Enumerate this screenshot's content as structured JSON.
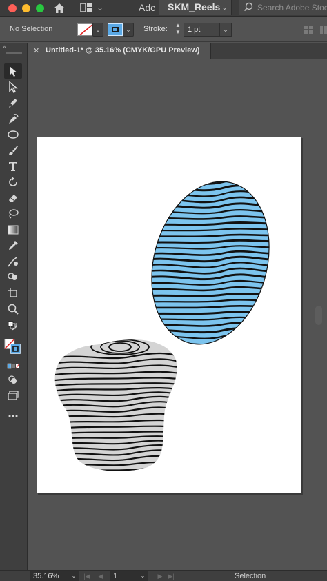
{
  "titlebar": {
    "app_short": "Adc",
    "document_switcher": "SKM_Reels",
    "search_placeholder": "Search Adobe Stock"
  },
  "controlbar": {
    "selection_status": "No Selection",
    "stroke_label": "Stroke:",
    "stroke_weight": "1 pt",
    "fill_color": "none",
    "stroke_color": "#5aa9e6"
  },
  "tab": {
    "title": "Untitled-1* @ 35.16% (CMYK/GPU Preview)"
  },
  "toolbar": {
    "tools": [
      "selection-tool-icon",
      "direct-selection-tool-icon",
      "pen-tool-icon",
      "curvature-tool-icon",
      "ellipse-tool-icon",
      "paintbrush-tool-icon",
      "type-tool-icon",
      "rotate-tool-icon",
      "eraser-tool-icon",
      "lasso-tool-icon",
      "gradient-tool-icon",
      "eyedropper-tool-icon",
      "blend-tool-icon",
      "shape-builder-tool-icon",
      "artboard-tool-icon",
      "zoom-tool-icon"
    ]
  },
  "artwork": {
    "egg_fill": "#7cc4ee",
    "blob_fill": "#d4d4d4",
    "stripe_color": "#111111"
  },
  "statusbar": {
    "zoom": "35.16%",
    "artboard_number": "1",
    "current_tool": "Selection"
  }
}
